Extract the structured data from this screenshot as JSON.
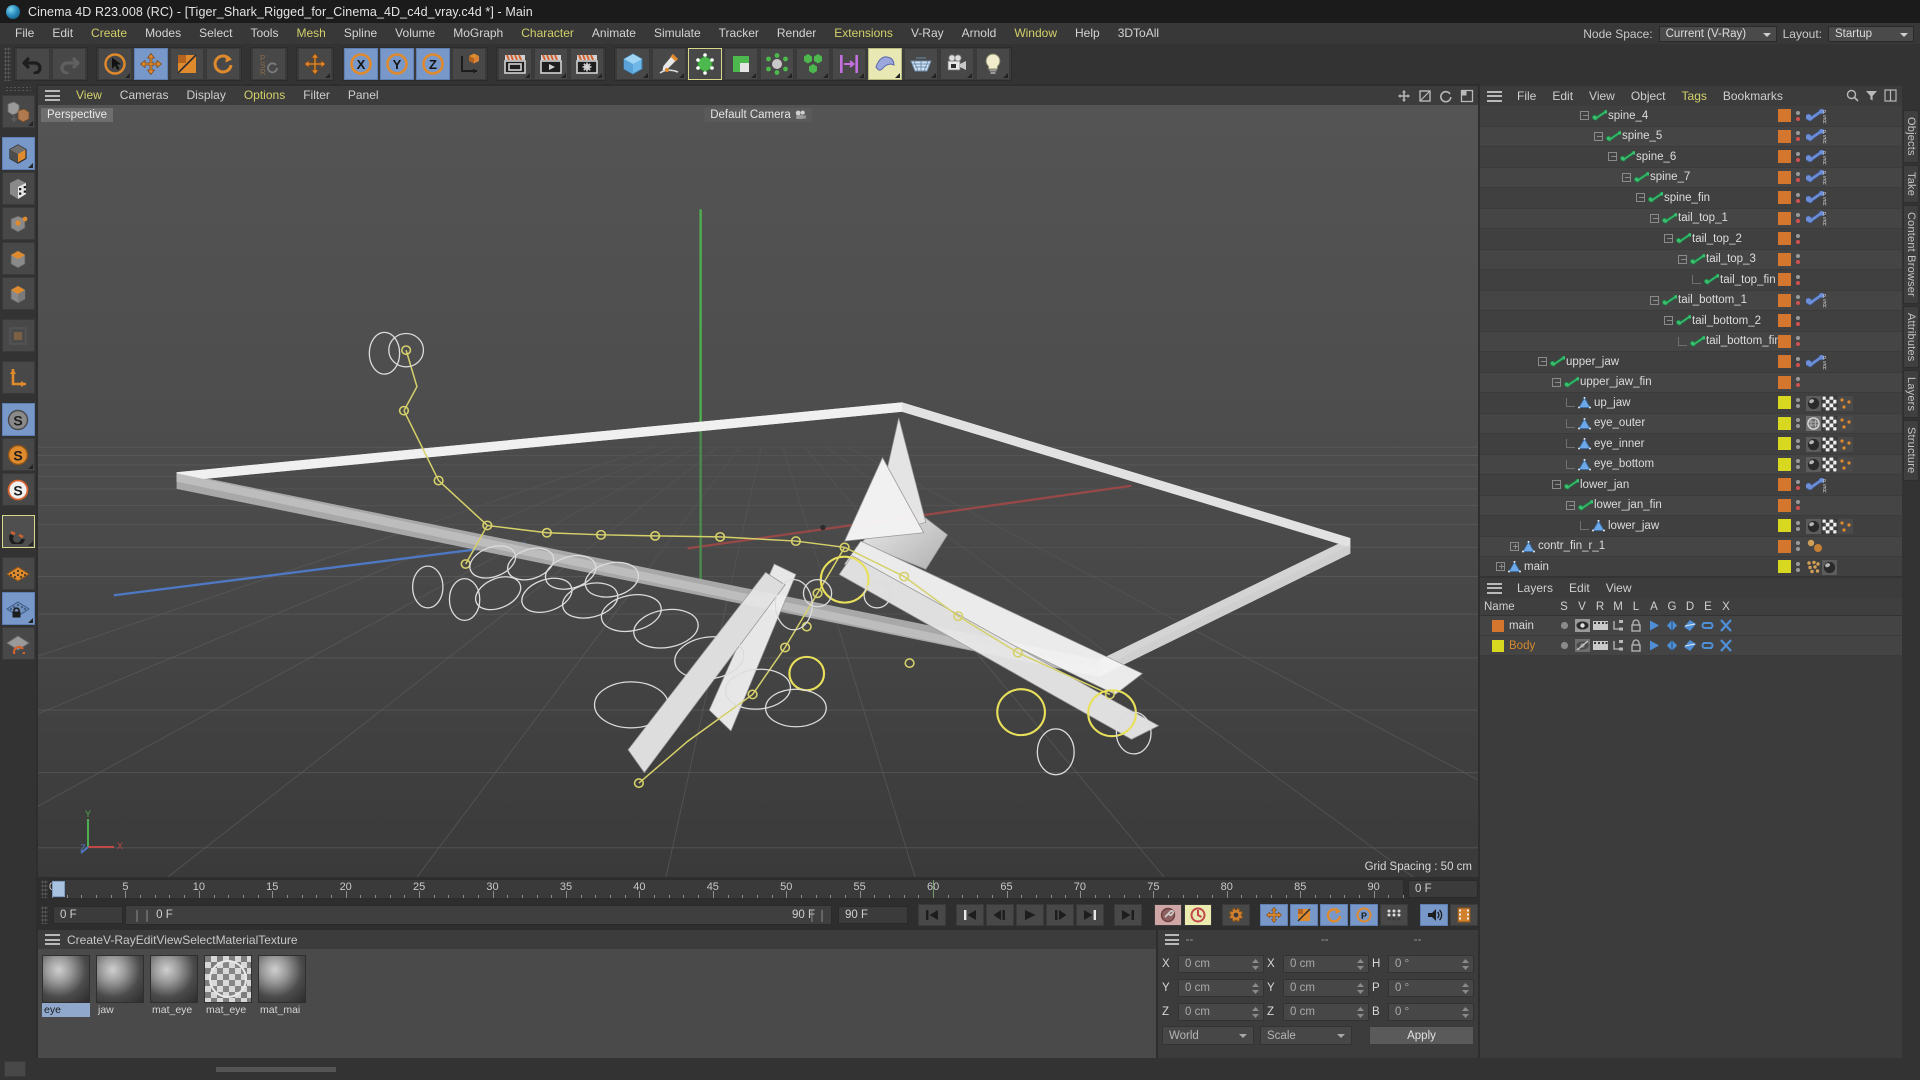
{
  "window": {
    "title": "Cinema 4D R23.008 (RC) - [Tiger_Shark_Rigged_for_Cinema_4D_c4d_vray.c4d *] - Main"
  },
  "menubar": {
    "items": [
      {
        "label": "File",
        "accent": false
      },
      {
        "label": "Edit",
        "accent": false
      },
      {
        "label": "Create",
        "accent": true
      },
      {
        "label": "Modes",
        "accent": false
      },
      {
        "label": "Select",
        "accent": false
      },
      {
        "label": "Tools",
        "accent": false
      },
      {
        "label": "Mesh",
        "accent": true
      },
      {
        "label": "Spline",
        "accent": false
      },
      {
        "label": "Volume",
        "accent": false
      },
      {
        "label": "MoGraph",
        "accent": false
      },
      {
        "label": "Character",
        "accent": true
      },
      {
        "label": "Animate",
        "accent": false
      },
      {
        "label": "Simulate",
        "accent": false
      },
      {
        "label": "Tracker",
        "accent": false
      },
      {
        "label": "Render",
        "accent": false
      },
      {
        "label": "Extensions",
        "accent": true
      },
      {
        "label": "V-Ray",
        "accent": false
      },
      {
        "label": "Arnold",
        "accent": false
      },
      {
        "label": "Window",
        "accent": true
      },
      {
        "label": "Help",
        "accent": false
      },
      {
        "label": "3DToAll",
        "accent": false
      }
    ],
    "node_space_label": "Node Space:",
    "node_space_value": "Current (V-Ray)",
    "layout_label": "Layout:",
    "layout_value": "Startup"
  },
  "viewport": {
    "menu": [
      {
        "label": "View",
        "accent": true
      },
      {
        "label": "Cameras",
        "accent": false
      },
      {
        "label": "Display",
        "accent": false
      },
      {
        "label": "Options",
        "accent": true
      },
      {
        "label": "Filter",
        "accent": false
      },
      {
        "label": "Panel",
        "accent": false
      }
    ],
    "projection_label": "Perspective",
    "camera_label": "Default Camera",
    "grid_spacing": "Grid Spacing : 50 cm",
    "axis_x": "X",
    "axis_y": "Y",
    "axis_z": "Z"
  },
  "timeline": {
    "ticks": [
      {
        "value": "0",
        "pos": 0
      },
      {
        "value": "5",
        "pos": 5
      },
      {
        "value": "10",
        "pos": 10
      },
      {
        "value": "15",
        "pos": 15
      },
      {
        "value": "20",
        "pos": 20
      },
      {
        "value": "25",
        "pos": 25
      },
      {
        "value": "30",
        "pos": 30
      },
      {
        "value": "35",
        "pos": 35
      },
      {
        "value": "40",
        "pos": 40
      },
      {
        "value": "45",
        "pos": 45
      },
      {
        "value": "50",
        "pos": 50
      },
      {
        "value": "55",
        "pos": 55
      },
      {
        "value": "60",
        "pos": 60
      },
      {
        "value": "65",
        "pos": 65
      },
      {
        "value": "70",
        "pos": 70
      },
      {
        "value": "75",
        "pos": 75
      },
      {
        "value": "80",
        "pos": 80
      },
      {
        "value": "85",
        "pos": 85
      },
      {
        "value": "90",
        "pos": 90
      }
    ],
    "range_min": 0,
    "range_max": 92,
    "current_frame_top": "0 F",
    "current_frame": "0 F",
    "preview_start": "0 F",
    "preview_end": "90 F",
    "end_frame": "90 F"
  },
  "materials": {
    "menu": [
      {
        "label": "Create",
        "accent": true
      },
      {
        "label": "V-Ray",
        "accent": false
      },
      {
        "label": "Edit",
        "accent": false
      },
      {
        "label": "View",
        "accent": false
      },
      {
        "label": "Select",
        "accent": false
      },
      {
        "label": "Material",
        "accent": false
      },
      {
        "label": "Texture",
        "accent": false
      }
    ],
    "items": [
      {
        "name": "eye",
        "selected": true,
        "glass": false
      },
      {
        "name": "jaw",
        "selected": false,
        "glass": false
      },
      {
        "name": "mat_eye",
        "selected": false,
        "glass": false
      },
      {
        "name": "mat_eye",
        "selected": false,
        "glass": true
      },
      {
        "name": "mat_mai",
        "selected": false,
        "glass": false
      }
    ]
  },
  "coordinates": {
    "header_dashes": [
      "--",
      "--",
      "--"
    ],
    "rows": [
      {
        "label1": "X",
        "value1": "0 cm",
        "label2": "X",
        "value2": "0 cm",
        "label3": "H",
        "value3": "0 °"
      },
      {
        "label1": "Y",
        "value1": "0 cm",
        "label2": "Y",
        "value2": "0 cm",
        "label3": "P",
        "value3": "0 °"
      },
      {
        "label1": "Z",
        "value1": "0 cm",
        "label2": "Z",
        "value2": "0 cm",
        "label3": "B",
        "value3": "0 °"
      }
    ],
    "world_select": "World",
    "scale_select": "Scale",
    "apply_label": "Apply"
  },
  "object_manager": {
    "menu": [
      {
        "label": "File",
        "accent": false
      },
      {
        "label": "Edit",
        "accent": false
      },
      {
        "label": "View",
        "accent": false
      },
      {
        "label": "Object",
        "accent": false
      },
      {
        "label": "Tags",
        "accent": true
      },
      {
        "label": "Bookmarks",
        "accent": false
      }
    ],
    "rows": [
      {
        "name": "spine_4",
        "indent": 7,
        "icon": "bone",
        "box": "minus",
        "color": "#d5762e",
        "dot2": "#d05050",
        "tags": [
          "psr"
        ],
        "partial": true
      },
      {
        "name": "spine_5",
        "indent": 8,
        "icon": "bone",
        "box": "minus",
        "color": "#d5762e",
        "dot2": "#d05050",
        "tags": [
          "psr"
        ]
      },
      {
        "name": "spine_6",
        "indent": 9,
        "icon": "bone",
        "box": "minus",
        "color": "#d5762e",
        "dot2": "#d05050",
        "tags": [
          "psr"
        ]
      },
      {
        "name": "spine_7",
        "indent": 10,
        "icon": "bone",
        "box": "minus",
        "color": "#d5762e",
        "dot2": "#d05050",
        "tags": [
          "psr"
        ]
      },
      {
        "name": "spine_fin",
        "indent": 11,
        "icon": "bone",
        "box": "minus",
        "color": "#d5762e",
        "dot2": "#d05050",
        "tags": [
          "psr"
        ]
      },
      {
        "name": "tail_top_1",
        "indent": 12,
        "icon": "bone",
        "box": "minus",
        "color": "#d5762e",
        "dot2": "#d05050",
        "tags": [
          "psr"
        ]
      },
      {
        "name": "tail_top_2",
        "indent": 13,
        "icon": "bone",
        "box": "minus",
        "color": "#d5762e",
        "dot2": "#d05050",
        "tags": []
      },
      {
        "name": "tail_top_3",
        "indent": 14,
        "icon": "bone",
        "box": "minus",
        "color": "#d5762e",
        "dot2": "#d05050",
        "tags": []
      },
      {
        "name": "tail_top_fin",
        "indent": 15,
        "icon": "bone",
        "box": "elbow",
        "color": "#d5762e",
        "dot2": "#d05050",
        "tags": []
      },
      {
        "name": "tail_bottom_1",
        "indent": 12,
        "icon": "bone",
        "box": "minus",
        "color": "#d5762e",
        "dot2": "#d05050",
        "tags": [
          "psr"
        ]
      },
      {
        "name": "tail_bottom_2",
        "indent": 13,
        "icon": "bone",
        "box": "minus",
        "color": "#d5762e",
        "dot2": "#d05050",
        "tags": []
      },
      {
        "name": "tail_bottom_fin",
        "indent": 14,
        "icon": "bone",
        "box": "elbow",
        "color": "#d5762e",
        "dot2": "#d05050",
        "tags": []
      },
      {
        "name": "upper_jaw",
        "indent": 4,
        "icon": "bone",
        "box": "minus",
        "color": "#d5762e",
        "dot2": "#d05050",
        "tags": [
          "psr"
        ]
      },
      {
        "name": "upper_jaw_fin",
        "indent": 5,
        "icon": "bone",
        "box": "minus",
        "color": "#d5762e",
        "dot2": "#d05050",
        "tags": []
      },
      {
        "name": "up_jaw",
        "indent": 6,
        "icon": "mesh",
        "box": "tee",
        "color": "#d8d820",
        "dot2": "#9a9a9a",
        "tags": [
          "mat",
          "uv",
          "sel"
        ]
      },
      {
        "name": "eye_outer",
        "indent": 6,
        "icon": "mesh",
        "box": "tee",
        "color": "#d8d820",
        "dot2": "#9a9a9a",
        "tags": [
          "matg",
          "uv",
          "sel"
        ]
      },
      {
        "name": "eye_inner",
        "indent": 6,
        "icon": "mesh",
        "box": "tee",
        "color": "#d8d820",
        "dot2": "#9a9a9a",
        "tags": [
          "mat",
          "uv",
          "sel"
        ]
      },
      {
        "name": "eye_bottom",
        "indent": 6,
        "icon": "mesh",
        "box": "elbow",
        "color": "#d8d820",
        "dot2": "#9a9a9a",
        "tags": [
          "mat",
          "uv",
          "sel"
        ]
      },
      {
        "name": "lower_jan",
        "indent": 5,
        "icon": "bone",
        "box": "minus",
        "color": "#d5762e",
        "dot2": "#d05050",
        "tags": [
          "psr"
        ]
      },
      {
        "name": "lower_jan_fin",
        "indent": 6,
        "icon": "bone",
        "box": "minus",
        "color": "#d5762e",
        "dot2": "#d05050",
        "tags": []
      },
      {
        "name": "lower_jaw",
        "indent": 7,
        "icon": "mesh",
        "box": "elbow",
        "color": "#d8d820",
        "dot2": "#9a9a9a",
        "tags": [
          "mat",
          "uv",
          "sel"
        ]
      },
      {
        "name": "contr_fin_r_1",
        "indent": 2,
        "icon": "mesh",
        "box": "plus",
        "color": "#d5762e",
        "dot2": "#9a9a9a",
        "tags": [
          "balls"
        ]
      },
      {
        "name": "main",
        "indent": 1,
        "icon": "mesh",
        "box": "plus",
        "color": "#d8d820",
        "dot2": "#9a9a9a",
        "tags": [
          "cluster",
          "mat"
        ]
      }
    ]
  },
  "layers": {
    "menu": [
      {
        "label": "Layers",
        "accent": false
      },
      {
        "label": "Edit",
        "accent": false
      },
      {
        "label": "View",
        "accent": false
      }
    ],
    "columns": [
      "Name",
      "S",
      "V",
      "R",
      "M",
      "L",
      "A",
      "G",
      "D",
      "E",
      "X"
    ],
    "rows": [
      {
        "name": "main",
        "color": "#d5762e",
        "name_color": "#d8d8d8",
        "eye_on": true
      },
      {
        "name": "Body",
        "color": "#d8d820",
        "name_color": "#d58a2e",
        "eye_on": false
      }
    ]
  },
  "right_tabs": [
    "Objects",
    "Take",
    "Content Browser",
    "Attributes",
    "Layers",
    "Structure"
  ],
  "colors": {
    "accent_menu": "#d3d06a",
    "selection_blue": "#7798c9",
    "bone_orange": "#d5762e",
    "mesh_yellow": "#d8d820",
    "playhead": "#a8c2e0"
  }
}
